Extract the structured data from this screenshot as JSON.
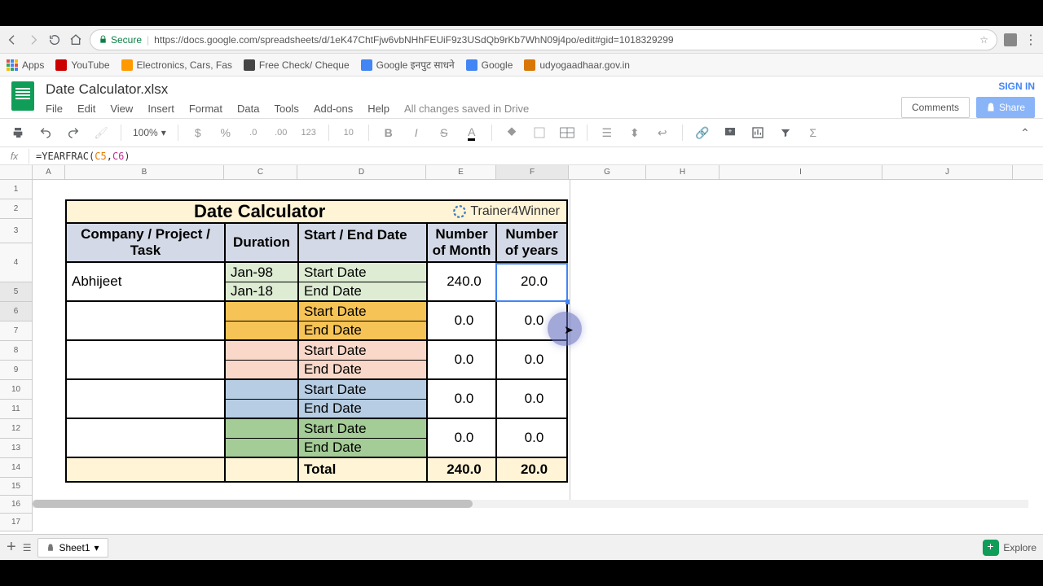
{
  "url": "https://docs.google.com/spreadsheets/d/1eK47ChtFjw6vbNHhFEUiF9z3USdQb9rKb7WhN09j4po/edit#gid=1018329299",
  "secure_label": "Secure",
  "bookmarks": {
    "apps": "Apps",
    "youtube": "YouTube",
    "electronics": "Electronics, Cars, Fas",
    "freecheck": "Free Check/ Cheque",
    "google_input": "Google इनपुट साधने",
    "google": "Google",
    "udyog": "udyogaadhaar.gov.in"
  },
  "doc": {
    "title": "Date Calculator.xlsx",
    "save_status": "All changes saved in Drive"
  },
  "menus": {
    "file": "File",
    "edit": "Edit",
    "view": "View",
    "insert": "Insert",
    "format": "Format",
    "data": "Data",
    "tools": "Tools",
    "addons": "Add-ons",
    "help": "Help"
  },
  "header": {
    "signin": "SIGN IN",
    "comments": "Comments",
    "share": "Share"
  },
  "toolbar": {
    "zoom": "100%",
    "format_num": "123",
    "font_size": "10"
  },
  "formula": {
    "fn": "=YEARFRAC(",
    "ref1": "C5",
    "comma": ",",
    "ref2": "C6",
    "close": ")"
  },
  "columns": [
    "A",
    "B",
    "C",
    "D",
    "E",
    "F",
    "G",
    "H",
    "I",
    "J"
  ],
  "rows": [
    "1",
    "2",
    "3",
    "4",
    "5",
    "6",
    "7",
    "8",
    "9",
    "10",
    "11",
    "12",
    "13",
    "14",
    "15",
    "16",
    "17"
  ],
  "sheet": {
    "title": "Date Calculator",
    "trainer": "Trainer4Winner",
    "headers": {
      "company": "Company / Project / Task",
      "duration": "Duration",
      "startend": "Start / End Date",
      "months": "Number of Month",
      "years": "Number of years"
    },
    "labels": {
      "start": "Start Date",
      "end": "End Date",
      "total": "Total"
    },
    "rows": [
      {
        "company": "Abhijeet",
        "dur_start": "Jan-98",
        "dur_end": "Jan-18",
        "months": "240.0",
        "years": "20.0"
      },
      {
        "company": "",
        "dur_start": "",
        "dur_end": "",
        "months": "0.0",
        "years": "0.0"
      },
      {
        "company": "",
        "dur_start": "",
        "dur_end": "",
        "months": "0.0",
        "years": "0.0"
      },
      {
        "company": "",
        "dur_start": "",
        "dur_end": "",
        "months": "0.0",
        "years": "0.0"
      },
      {
        "company": "",
        "dur_start": "",
        "dur_end": "",
        "months": "0.0",
        "years": "0.0"
      }
    ],
    "total": {
      "months": "240.0",
      "years": "20.0"
    }
  },
  "tabs": {
    "sheet1": "Sheet1",
    "explore": "Explore"
  }
}
